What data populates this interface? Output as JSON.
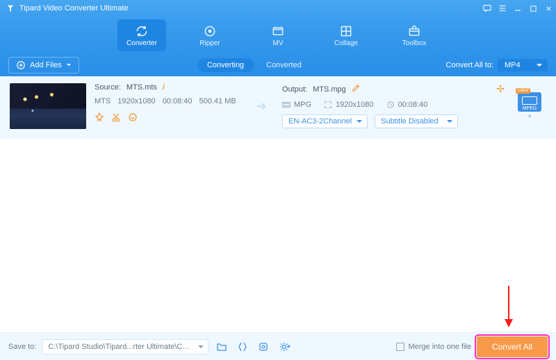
{
  "titlebar": {
    "title": "Tipard Video Converter Ultimate"
  },
  "tabs": {
    "converter": "Converter",
    "ripper": "Ripper",
    "mv": "MV",
    "collage": "Collage",
    "toolbox": "Toolbox"
  },
  "optbar": {
    "add_files": "Add Files",
    "converting": "Converting",
    "converted": "Converted",
    "convert_all_to": "Convert All to:",
    "format_selected": "MP4"
  },
  "item": {
    "source_label": "Source:",
    "source_file": "MTS.mts",
    "codec": "MTS",
    "resolution": "1920x1080",
    "duration": "00:08:40",
    "size": "500.41 MB",
    "output_label": "Output:",
    "output_file": "MTS.mpg",
    "out_codec": "MPG",
    "out_resolution": "1920x1080",
    "out_duration": "00:08:40",
    "audio_select": "EN-AC3-2Channel",
    "subtitle_select": "Subtitle Disabled",
    "format_badge": "MPEG"
  },
  "footer": {
    "save_to_label": "Save to:",
    "save_path": "C:\\Tipard Studio\\Tipard...rter Ultimate\\Converted",
    "merge_label": "Merge into one file",
    "convert_all": "Convert All"
  }
}
